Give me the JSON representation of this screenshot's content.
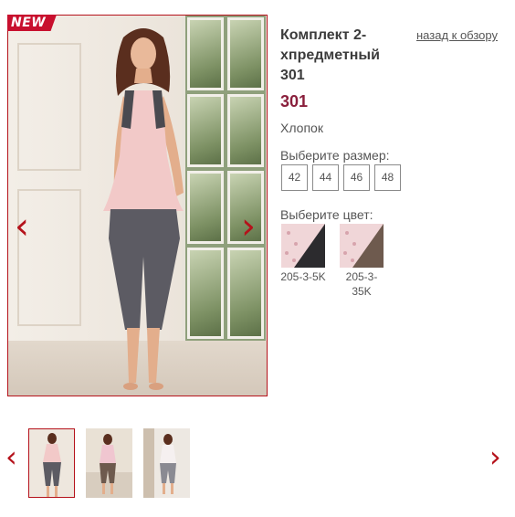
{
  "badge": {
    "text": "NEW"
  },
  "gallery": {
    "main_image_alt": "model wearing pink top and grey capri leggings",
    "prev_arrow": "‹",
    "next_arrow": "›",
    "thumbnails": [
      {
        "label": "thumbnail-1",
        "active": true
      },
      {
        "label": "thumbnail-2",
        "active": false
      },
      {
        "label": "thumbnail-3",
        "active": false
      }
    ],
    "thumb_prev_arrow": "‹",
    "thumb_next_arrow": "›"
  },
  "product": {
    "title": "Комплект 2-хпредметный 301",
    "price": "301",
    "material": "Хлопок",
    "back_link": "назад к обзору"
  },
  "sizes": {
    "label": "Выберите размер:",
    "options": [
      "42",
      "44",
      "46",
      "48"
    ]
  },
  "colors": {
    "label": "Выберите цвет:",
    "options": [
      {
        "code": "205-3-5K",
        "base": "#f0d6d8",
        "accent": "#2c2b2e"
      },
      {
        "code": "205-3-35K",
        "base": "#f0d6d8",
        "accent": "#6e5a4e"
      }
    ]
  },
  "theme": {
    "accent": "#b5121b",
    "price_color": "#8a1f3c",
    "badge_color": "#c8102e"
  }
}
